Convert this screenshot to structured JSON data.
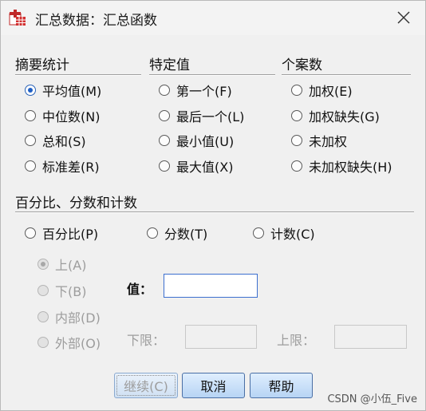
{
  "window": {
    "title": "汇总数据：汇总函数"
  },
  "groups": {
    "summary": {
      "title": "摘要统计",
      "items": [
        {
          "label": "平均值(M)",
          "checked": true
        },
        {
          "label": "中位数(N)",
          "checked": false
        },
        {
          "label": "总和(S)",
          "checked": false
        },
        {
          "label": "标准差(R)",
          "checked": false
        }
      ]
    },
    "specific": {
      "title": "特定值",
      "items": [
        {
          "label": "第一个(F)"
        },
        {
          "label": "最后一个(L)"
        },
        {
          "label": "最小值(U)"
        },
        {
          "label": "最大值(X)"
        }
      ]
    },
    "count": {
      "title": "个案数",
      "items": [
        {
          "label": "加权(E)"
        },
        {
          "label": "加权缺失(G)"
        },
        {
          "label": "未加权"
        },
        {
          "label": "未加权缺失(H)"
        }
      ]
    },
    "percent": {
      "title": "百分比、分数和计数",
      "items": [
        {
          "label": "百分比(P)"
        },
        {
          "label": "分数(T)"
        },
        {
          "label": "计数(C)"
        }
      ],
      "sub_options": [
        {
          "label": "上(A)",
          "checked": true
        },
        {
          "label": "下(B)",
          "checked": false
        },
        {
          "label": "内部(D)",
          "checked": false
        },
        {
          "label": "外部(O)",
          "checked": false
        }
      ],
      "value_label": "值：",
      "value": "",
      "lower_label": "下限：",
      "upper_label": "上限："
    }
  },
  "buttons": {
    "continue": "继续(C)",
    "cancel": "取消",
    "help": "帮助"
  },
  "watermark": "CSDN @小伍_Five",
  "colors": {
    "accent": "#1f5fc5",
    "button_border": "#4a6fa5",
    "disabled_text": "#9d9d9d"
  }
}
